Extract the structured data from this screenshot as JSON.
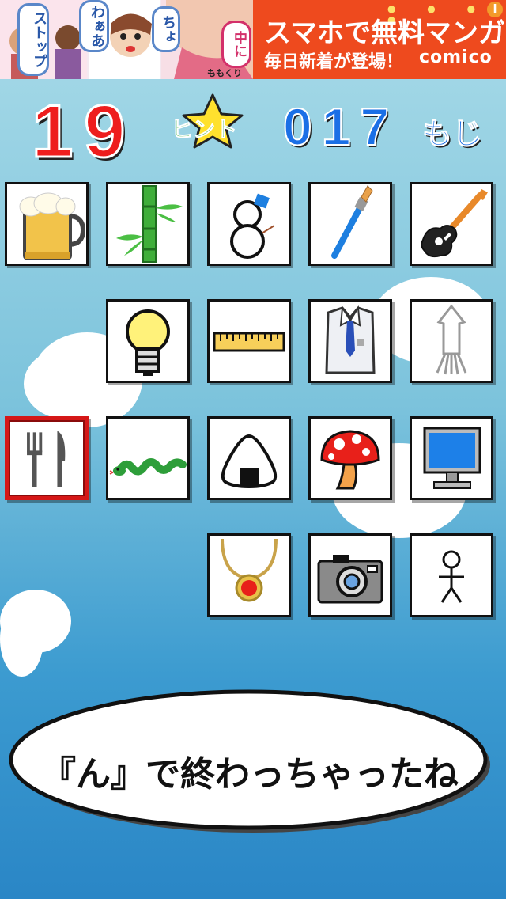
{
  "ad": {
    "bubbles": [
      "ストップ",
      "わぁあ",
      "ちょ",
      "中に"
    ],
    "artist": "ももくり",
    "headline": "スマホで無料マンガ",
    "subline": "毎日新着が登場！",
    "brand": "comico",
    "info_icon": "i"
  },
  "hud": {
    "score": "19",
    "hint_label": "ヒント",
    "char_count": "017",
    "char_unit": "もじ"
  },
  "tiles": [
    {
      "icon": "beer-mug-icon"
    },
    {
      "icon": "bamboo-icon"
    },
    {
      "icon": "snowman-icon"
    },
    {
      "icon": "paintbrush-icon"
    },
    {
      "icon": "guitar-icon"
    },
    {
      "icon": "light-bulb-icon"
    },
    {
      "icon": "ruler-icon"
    },
    {
      "icon": "shirt-tie-icon"
    },
    {
      "icon": "squid-icon"
    },
    {
      "icon": "fork-knife-icon",
      "selected": true
    },
    {
      "icon": "snake-icon"
    },
    {
      "icon": "rice-ball-icon"
    },
    {
      "icon": "mushroom-icon"
    },
    {
      "icon": "computer-monitor-icon"
    },
    {
      "icon": "necklace-icon"
    },
    {
      "icon": "camera-icon"
    },
    {
      "icon": "stick-figure-icon"
    }
  ],
  "message": "『ん』で終わっちゃったね",
  "colors": {
    "score": "#ee1d1d",
    "count": "#1b6fe6",
    "hint": "#29a82d",
    "selected_border": "#d51717",
    "ad_right_bg": "#ee4a1e"
  }
}
